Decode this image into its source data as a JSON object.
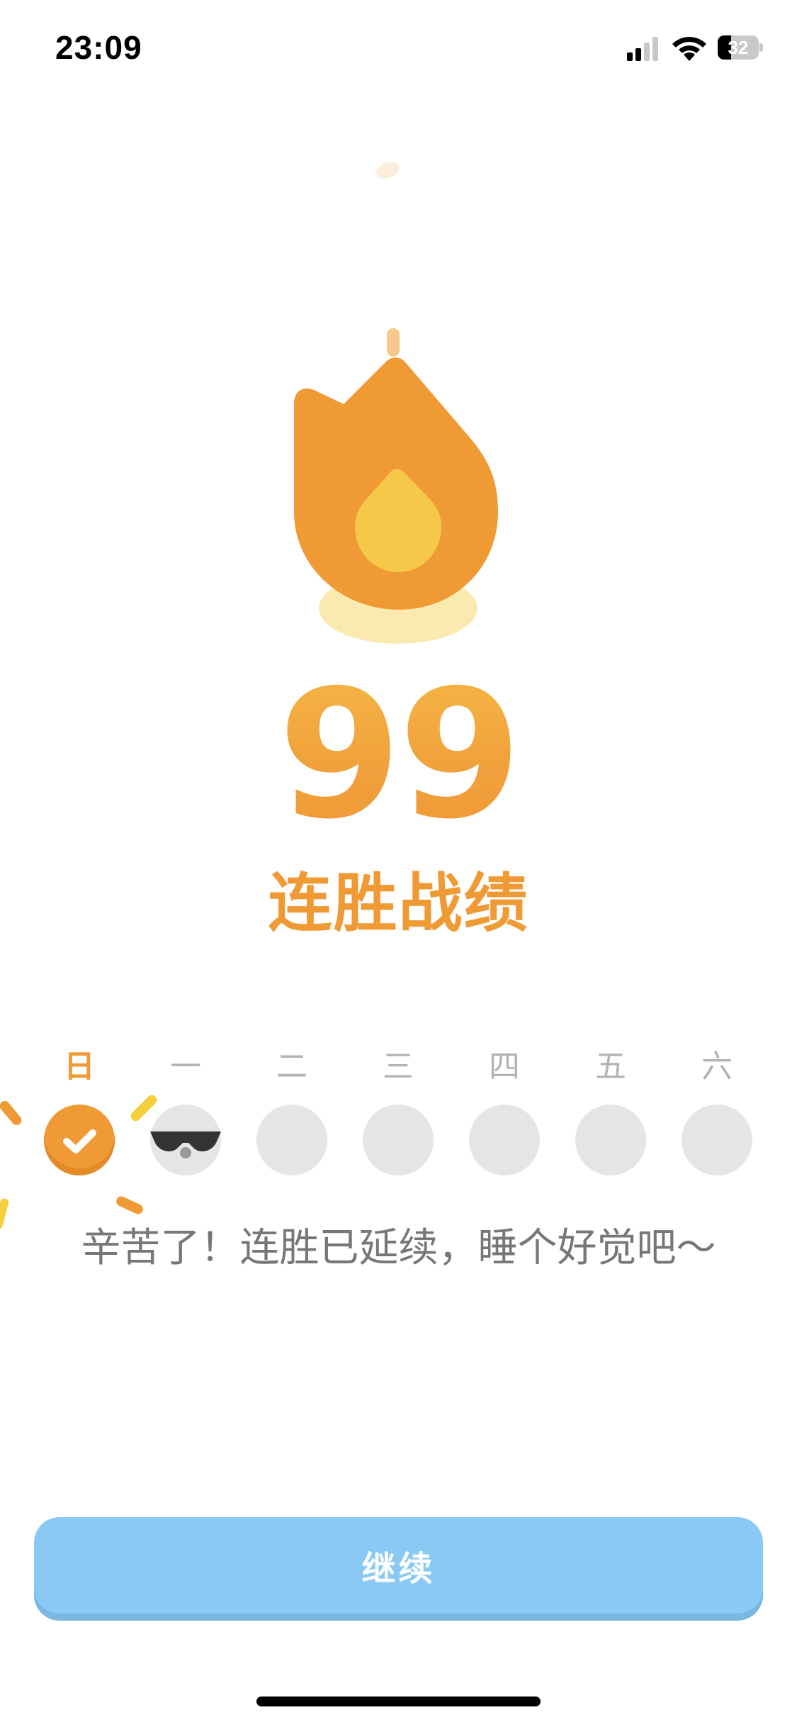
{
  "status_bar": {
    "time": "23:09",
    "battery_level": "32",
    "signal_icon": "cellular-signal-icon",
    "wifi_icon": "wifi-icon",
    "battery_icon": "battery-icon"
  },
  "streak": {
    "icon": "flame-icon",
    "count": "99",
    "title": "连胜战绩"
  },
  "week": {
    "days": [
      {
        "label": "日",
        "state": "done"
      },
      {
        "label": "一",
        "state": "freeze"
      },
      {
        "label": "二",
        "state": "empty"
      },
      {
        "label": "三",
        "state": "empty"
      },
      {
        "label": "四",
        "state": "empty"
      },
      {
        "label": "五",
        "state": "empty"
      },
      {
        "label": "六",
        "state": "empty"
      }
    ]
  },
  "message": "辛苦了！连胜已延续，睡个好觉吧～",
  "continue_button": {
    "label": "继续"
  },
  "colors": {
    "accent_orange": "#ef9a35",
    "flame_inner": "#f5c84a",
    "button_blue": "#89c9f3",
    "inactive_gray": "#e5e5e5"
  }
}
